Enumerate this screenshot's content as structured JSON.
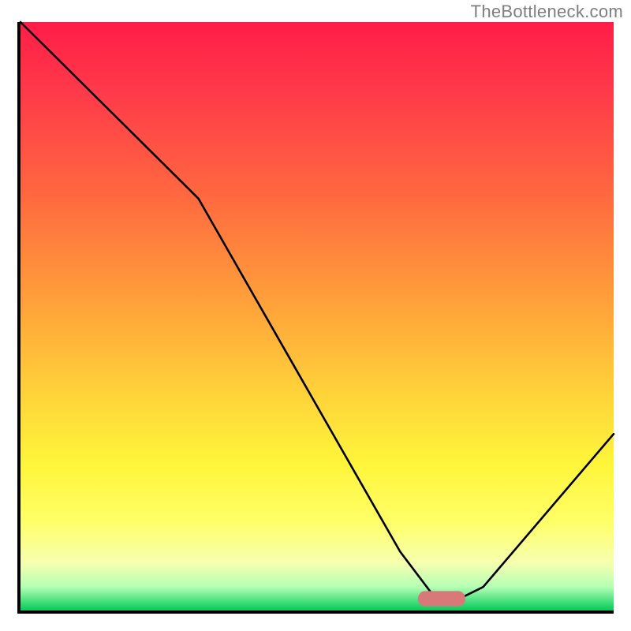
{
  "watermark": "TheBottleneck.com",
  "chart_data": {
    "type": "line",
    "title": "",
    "xlabel": "",
    "ylabel": "",
    "xlim": [
      0,
      100
    ],
    "ylim": [
      0,
      100
    ],
    "x": [
      0,
      26,
      30,
      64,
      70,
      74,
      78,
      100
    ],
    "values": [
      100,
      74,
      70,
      10,
      2,
      2,
      4,
      30
    ],
    "marker": {
      "x_center": 71,
      "y": 2,
      "width": 8,
      "height": 2.6
    },
    "gradient_stops": [
      {
        "pos": 0,
        "color": "#ff1d47"
      },
      {
        "pos": 12,
        "color": "#ff3a4a"
      },
      {
        "pos": 30,
        "color": "#ff6a3f"
      },
      {
        "pos": 48,
        "color": "#ffa23a"
      },
      {
        "pos": 63,
        "color": "#ffd23a"
      },
      {
        "pos": 75,
        "color": "#fff53a"
      },
      {
        "pos": 85,
        "color": "#ffff68"
      },
      {
        "pos": 92,
        "color": "#f6ffb0"
      },
      {
        "pos": 96,
        "color": "#b4ffb4"
      },
      {
        "pos": 99,
        "color": "#2dd86f"
      },
      {
        "pos": 100,
        "color": "#11c45a"
      }
    ]
  }
}
